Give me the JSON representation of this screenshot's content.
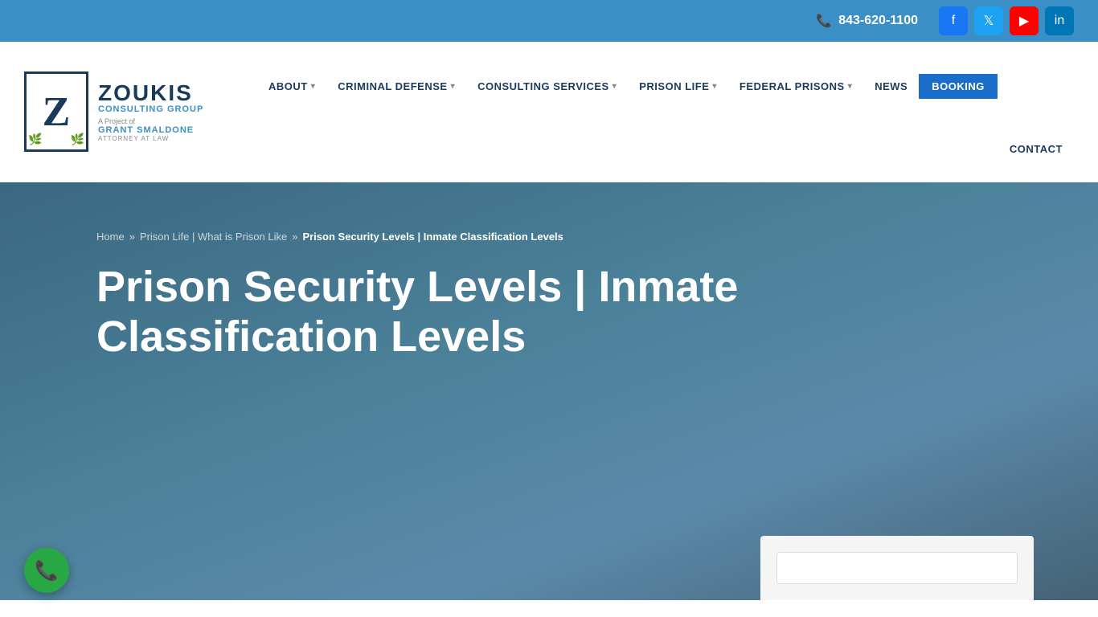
{
  "topbar": {
    "phone": "843-620-1100",
    "social": [
      {
        "name": "Facebook",
        "icon": "f",
        "class": "facebook"
      },
      {
        "name": "Twitter",
        "icon": "t",
        "class": "twitter"
      },
      {
        "name": "YouTube",
        "icon": "▶",
        "class": "youtube"
      },
      {
        "name": "LinkedIn",
        "icon": "in",
        "class": "linkedin"
      }
    ]
  },
  "logo": {
    "letter": "Z",
    "brand": "ZOUKIS",
    "sub": "CONSULTING GROUP",
    "project_label": "A Project of",
    "grant": "GRANT SMALDONE",
    "attorney": "ATTORNEY AT LAW"
  },
  "nav": {
    "items": [
      {
        "label": "ABOUT",
        "has_dropdown": true
      },
      {
        "label": "CRIMINAL DEFENSE",
        "has_dropdown": true
      },
      {
        "label": "CONSULTING SERVICES",
        "has_dropdown": true
      },
      {
        "label": "PRISON LIFE",
        "has_dropdown": true
      },
      {
        "label": "FEDERAL PRISONS",
        "has_dropdown": true
      },
      {
        "label": "NEWS",
        "has_dropdown": false
      },
      {
        "label": "BOOKING",
        "has_dropdown": false,
        "style": "booking"
      }
    ],
    "contact_label": "CONTACT"
  },
  "breadcrumb": {
    "home": "Home",
    "sep1": "»",
    "prison_life": "Prison Life | What is Prison Like",
    "sep2": "»",
    "current": "Prison Security Levels | Inmate Classification Levels"
  },
  "hero": {
    "title": "Prison Security Levels | Inmate Classification Levels"
  },
  "float_phone": {
    "label": "Call us"
  }
}
